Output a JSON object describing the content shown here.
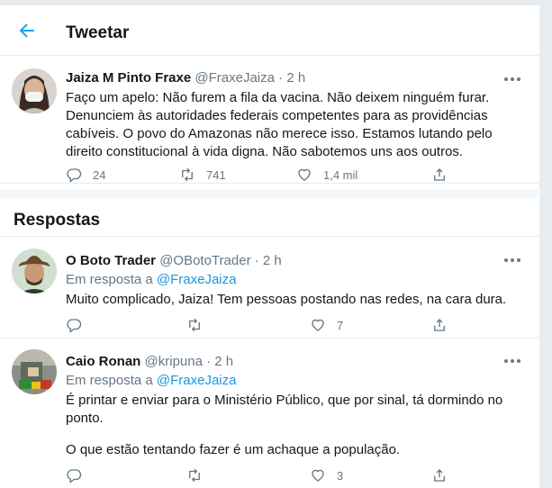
{
  "header": {
    "title": "Tweetar"
  },
  "main_tweet": {
    "name": "Jaiza M Pinto Fraxe",
    "handle": "@FraxeJaiza",
    "sep": "·",
    "time": "2 h",
    "text": "Faço um apelo: Não furem a fila da vacina. Não deixem ninguém furar. Denunciem às autoridades federais competentes para as providências cabíveis. O povo do Amazonas não merece isso. Estamos lutando pelo direito constitucional à vida digna. Não sabotemos uns aos outros.",
    "replies": "24",
    "retweets": "741",
    "likes": "1,4 mil"
  },
  "section": {
    "title": "Respostas"
  },
  "replies": [
    {
      "name": "O Boto Trader",
      "handle": "@OBotoTrader",
      "sep": "·",
      "time": "2 h",
      "reply_prefix": "Em resposta a ",
      "reply_to": "@FraxeJaiza",
      "text": "Muito complicado, Jaiza! Tem pessoas postando nas redes, na cara dura.",
      "likes": "7"
    },
    {
      "name": "Caio Ronan",
      "handle": "@kripuna",
      "sep": "·",
      "time": "2 h",
      "reply_prefix": "Em resposta a ",
      "reply_to": "@FraxeJaiza",
      "text_line1": "É printar e enviar para o Ministério Público, que por sinal, tá dormindo no ponto.",
      "text_line2": "O que estão tentando fazer é um achaque a população.",
      "likes": "3"
    }
  ],
  "colors": {
    "accent": "#1da1f2",
    "link": "#1b95e0",
    "muted": "#657786",
    "divider": "#e6ecf0"
  }
}
